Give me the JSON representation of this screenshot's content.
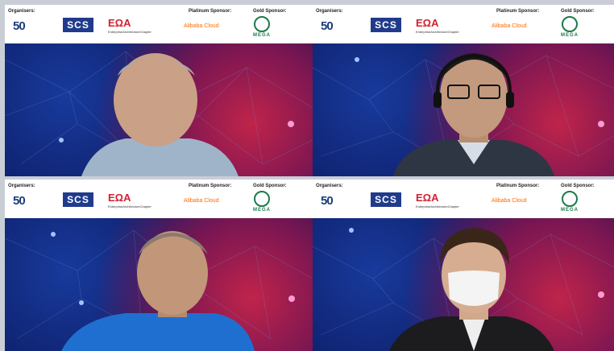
{
  "tiles": [
    {
      "banner": {
        "organisers_label": "Organisers:",
        "platinum_label": "Platinum Sponsor:",
        "gold_label": "Gold Sponsor:"
      },
      "logos": {
        "anniversary": "50",
        "anniversary_sub": "",
        "scs": "SCS",
        "eaa": "EΩA",
        "eaa_sub": "EnterpriseArchitectureChapter",
        "alibaba": "Alibaba Cloud",
        "mega": "MEGA"
      }
    },
    {
      "banner": {
        "organisers_label": "Organisers:",
        "platinum_label": "Platinum Sponsor:",
        "gold_label": "Gold Sponsor:"
      },
      "logos": {
        "anniversary": "50",
        "anniversary_sub": "",
        "scs": "SCS",
        "eaa": "EΩA",
        "eaa_sub": "EnterpriseArchitectureChapter",
        "alibaba": "Alibaba Cloud",
        "mega": "MEGA"
      }
    },
    {
      "banner": {
        "organisers_label": "Organisers:",
        "platinum_label": "Platinum Sponsor:",
        "gold_label": "Gold Sponsor:"
      },
      "logos": {
        "anniversary": "50",
        "anniversary_sub": "",
        "scs": "SCS",
        "eaa": "EΩA",
        "eaa_sub": "EnterpriseArchitectureChapter",
        "alibaba": "Alibaba Cloud",
        "mega": "MEGA"
      }
    },
    {
      "banner": {
        "organisers_label": "Organisers:",
        "platinum_label": "Platinum Sponsor:",
        "gold_label": "Gold Sponsor:"
      },
      "logos": {
        "anniversary": "50",
        "anniversary_sub": "",
        "scs": "SCS",
        "eaa": "EΩA",
        "eaa_sub": "EnterpriseArchitectureChapter",
        "alibaba": "Alibaba Cloud",
        "mega": "MEGA"
      }
    }
  ],
  "colors": {
    "scs_blue": "#1f3b8c",
    "eaa_red": "#d32030",
    "alibaba_orange": "#ff6a00",
    "mega_green": "#1b7a4a",
    "bg_blue": "#0e1f6a",
    "bg_magenta": "#c0244a"
  },
  "icons": {
    "video_tile": "participant-video"
  }
}
